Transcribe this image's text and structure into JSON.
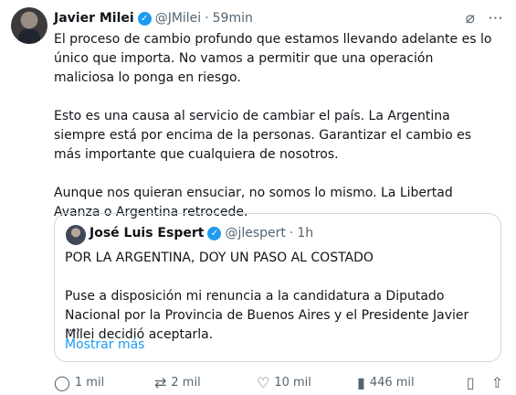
{
  "tweet": {
    "author": {
      "name": "Javier Milei",
      "handle": "@JMilei",
      "time": "59min"
    },
    "paragraphs": [
      "El proceso de cambio profundo que estamos llevando adelante es lo único que importa. No vamos a permitir que una operación maliciosa lo ponga en riesgo.",
      "Esto es una causa al servicio de cambiar el país. La Argentina siempre está por encima de la personas. Garantizar el cambio es más importante que cualquiera de nosotros.",
      "Aunque nos quieran ensuciar, no somos lo mismo. La Libertad Avanza o Argentina retrocede."
    ]
  },
  "quote": {
    "author": {
      "name": "José Luis Espert",
      "handle": "@jlespert",
      "time": "1h"
    },
    "paragraphs": [
      "POR LA ARGENTINA, DOY UN PASO AL COSTADO",
      "Puse a disposición mi renuncia a la candidatura a Diputado Nacional por la Provincia de Buenos Aires y el Presidente Javier Milei decidió aceptarla."
    ],
    "ellipsis": "...",
    "show_more": "Mostrar más"
  },
  "actions": {
    "replies": "1 mil",
    "reposts": "2 mil",
    "likes": "10 mil",
    "views": "446 mil"
  },
  "icons": {
    "verified": "verified-badge-icon",
    "grok": "grok-icon",
    "more": "more-icon",
    "reply": "reply-icon",
    "repost": "repost-icon",
    "like": "like-icon",
    "views": "views-icon",
    "bookmark": "bookmark-icon",
    "share": "share-icon"
  }
}
